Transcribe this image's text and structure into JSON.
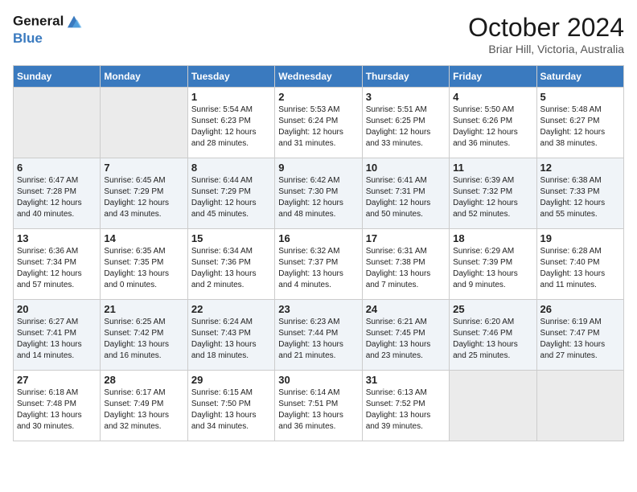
{
  "header": {
    "logo_line1": "General",
    "logo_line2": "Blue",
    "month": "October 2024",
    "location": "Briar Hill, Victoria, Australia"
  },
  "days_of_week": [
    "Sunday",
    "Monday",
    "Tuesday",
    "Wednesday",
    "Thursday",
    "Friday",
    "Saturday"
  ],
  "weeks": [
    [
      {
        "day": "",
        "empty": true
      },
      {
        "day": "",
        "empty": true
      },
      {
        "day": "1",
        "sunrise": "Sunrise: 5:54 AM",
        "sunset": "Sunset: 6:23 PM",
        "daylight": "Daylight: 12 hours and 28 minutes."
      },
      {
        "day": "2",
        "sunrise": "Sunrise: 5:53 AM",
        "sunset": "Sunset: 6:24 PM",
        "daylight": "Daylight: 12 hours and 31 minutes."
      },
      {
        "day": "3",
        "sunrise": "Sunrise: 5:51 AM",
        "sunset": "Sunset: 6:25 PM",
        "daylight": "Daylight: 12 hours and 33 minutes."
      },
      {
        "day": "4",
        "sunrise": "Sunrise: 5:50 AM",
        "sunset": "Sunset: 6:26 PM",
        "daylight": "Daylight: 12 hours and 36 minutes."
      },
      {
        "day": "5",
        "sunrise": "Sunrise: 5:48 AM",
        "sunset": "Sunset: 6:27 PM",
        "daylight": "Daylight: 12 hours and 38 minutes."
      }
    ],
    [
      {
        "day": "6",
        "sunrise": "Sunrise: 6:47 AM",
        "sunset": "Sunset: 7:28 PM",
        "daylight": "Daylight: 12 hours and 40 minutes."
      },
      {
        "day": "7",
        "sunrise": "Sunrise: 6:45 AM",
        "sunset": "Sunset: 7:29 PM",
        "daylight": "Daylight: 12 hours and 43 minutes."
      },
      {
        "day": "8",
        "sunrise": "Sunrise: 6:44 AM",
        "sunset": "Sunset: 7:29 PM",
        "daylight": "Daylight: 12 hours and 45 minutes."
      },
      {
        "day": "9",
        "sunrise": "Sunrise: 6:42 AM",
        "sunset": "Sunset: 7:30 PM",
        "daylight": "Daylight: 12 hours and 48 minutes."
      },
      {
        "day": "10",
        "sunrise": "Sunrise: 6:41 AM",
        "sunset": "Sunset: 7:31 PM",
        "daylight": "Daylight: 12 hours and 50 minutes."
      },
      {
        "day": "11",
        "sunrise": "Sunrise: 6:39 AM",
        "sunset": "Sunset: 7:32 PM",
        "daylight": "Daylight: 12 hours and 52 minutes."
      },
      {
        "day": "12",
        "sunrise": "Sunrise: 6:38 AM",
        "sunset": "Sunset: 7:33 PM",
        "daylight": "Daylight: 12 hours and 55 minutes."
      }
    ],
    [
      {
        "day": "13",
        "sunrise": "Sunrise: 6:36 AM",
        "sunset": "Sunset: 7:34 PM",
        "daylight": "Daylight: 12 hours and 57 minutes."
      },
      {
        "day": "14",
        "sunrise": "Sunrise: 6:35 AM",
        "sunset": "Sunset: 7:35 PM",
        "daylight": "Daylight: 13 hours and 0 minutes."
      },
      {
        "day": "15",
        "sunrise": "Sunrise: 6:34 AM",
        "sunset": "Sunset: 7:36 PM",
        "daylight": "Daylight: 13 hours and 2 minutes."
      },
      {
        "day": "16",
        "sunrise": "Sunrise: 6:32 AM",
        "sunset": "Sunset: 7:37 PM",
        "daylight": "Daylight: 13 hours and 4 minutes."
      },
      {
        "day": "17",
        "sunrise": "Sunrise: 6:31 AM",
        "sunset": "Sunset: 7:38 PM",
        "daylight": "Daylight: 13 hours and 7 minutes."
      },
      {
        "day": "18",
        "sunrise": "Sunrise: 6:29 AM",
        "sunset": "Sunset: 7:39 PM",
        "daylight": "Daylight: 13 hours and 9 minutes."
      },
      {
        "day": "19",
        "sunrise": "Sunrise: 6:28 AM",
        "sunset": "Sunset: 7:40 PM",
        "daylight": "Daylight: 13 hours and 11 minutes."
      }
    ],
    [
      {
        "day": "20",
        "sunrise": "Sunrise: 6:27 AM",
        "sunset": "Sunset: 7:41 PM",
        "daylight": "Daylight: 13 hours and 14 minutes."
      },
      {
        "day": "21",
        "sunrise": "Sunrise: 6:25 AM",
        "sunset": "Sunset: 7:42 PM",
        "daylight": "Daylight: 13 hours and 16 minutes."
      },
      {
        "day": "22",
        "sunrise": "Sunrise: 6:24 AM",
        "sunset": "Sunset: 7:43 PM",
        "daylight": "Daylight: 13 hours and 18 minutes."
      },
      {
        "day": "23",
        "sunrise": "Sunrise: 6:23 AM",
        "sunset": "Sunset: 7:44 PM",
        "daylight": "Daylight: 13 hours and 21 minutes."
      },
      {
        "day": "24",
        "sunrise": "Sunrise: 6:21 AM",
        "sunset": "Sunset: 7:45 PM",
        "daylight": "Daylight: 13 hours and 23 minutes."
      },
      {
        "day": "25",
        "sunrise": "Sunrise: 6:20 AM",
        "sunset": "Sunset: 7:46 PM",
        "daylight": "Daylight: 13 hours and 25 minutes."
      },
      {
        "day": "26",
        "sunrise": "Sunrise: 6:19 AM",
        "sunset": "Sunset: 7:47 PM",
        "daylight": "Daylight: 13 hours and 27 minutes."
      }
    ],
    [
      {
        "day": "27",
        "sunrise": "Sunrise: 6:18 AM",
        "sunset": "Sunset: 7:48 PM",
        "daylight": "Daylight: 13 hours and 30 minutes."
      },
      {
        "day": "28",
        "sunrise": "Sunrise: 6:17 AM",
        "sunset": "Sunset: 7:49 PM",
        "daylight": "Daylight: 13 hours and 32 minutes."
      },
      {
        "day": "29",
        "sunrise": "Sunrise: 6:15 AM",
        "sunset": "Sunset: 7:50 PM",
        "daylight": "Daylight: 13 hours and 34 minutes."
      },
      {
        "day": "30",
        "sunrise": "Sunrise: 6:14 AM",
        "sunset": "Sunset: 7:51 PM",
        "daylight": "Daylight: 13 hours and 36 minutes."
      },
      {
        "day": "31",
        "sunrise": "Sunrise: 6:13 AM",
        "sunset": "Sunset: 7:52 PM",
        "daylight": "Daylight: 13 hours and 39 minutes."
      },
      {
        "day": "",
        "empty": true
      },
      {
        "day": "",
        "empty": true
      }
    ]
  ]
}
